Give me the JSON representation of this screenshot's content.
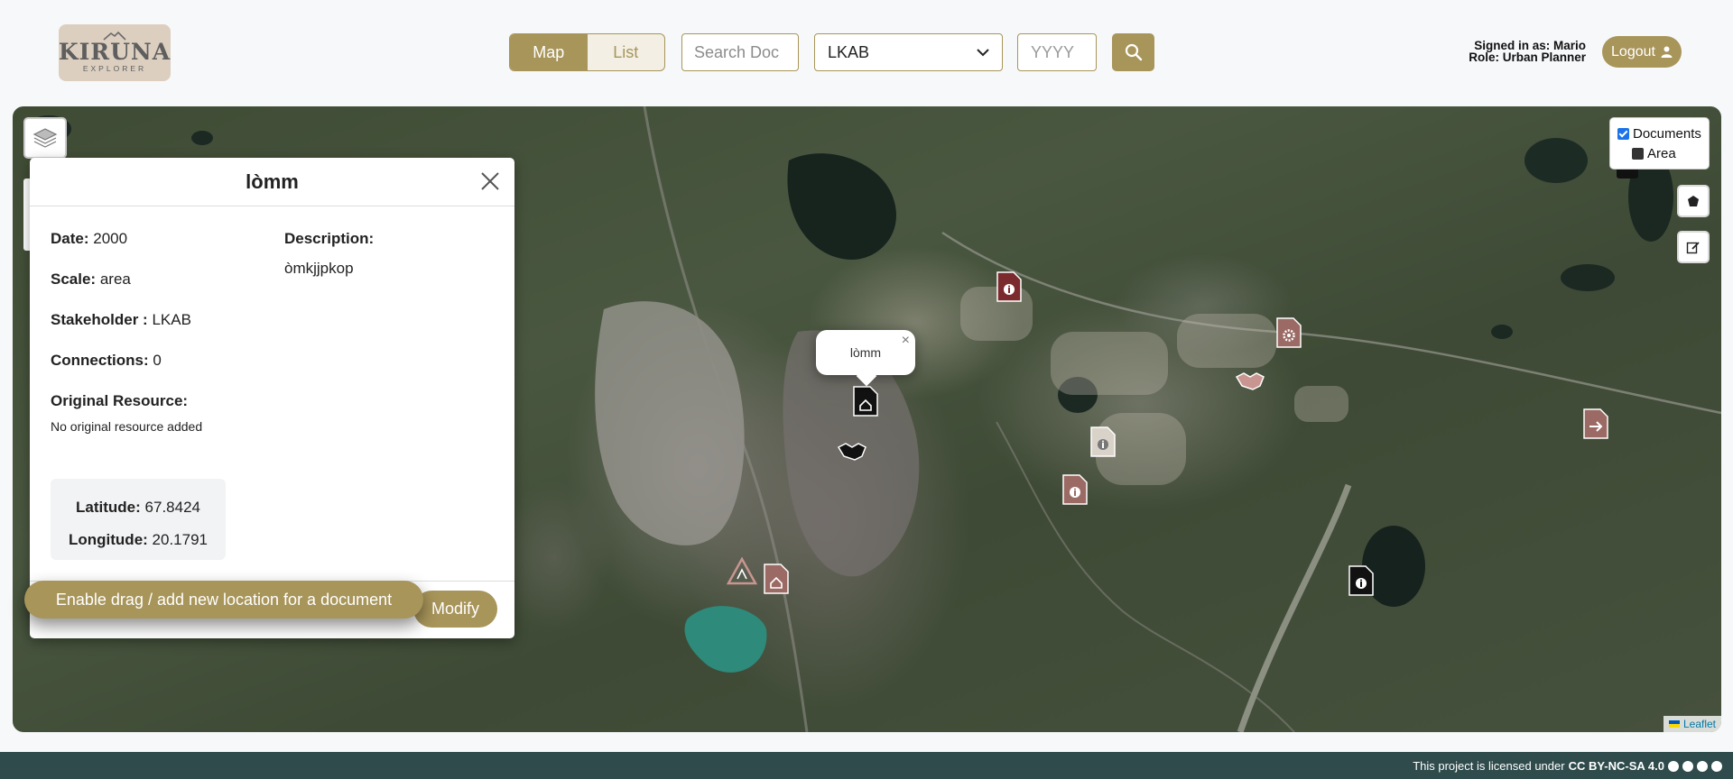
{
  "brand": {
    "logo_main": "KIRUNA",
    "logo_sub": "EXPLORER"
  },
  "view_toggle": {
    "map_label": "Map",
    "list_label": "List",
    "active": "Map"
  },
  "filters": {
    "search_placeholder": "Search Doc",
    "stakeholder_selected": "LKAB",
    "year_placeholder": "YYYY",
    "search_icon": "search-icon"
  },
  "user": {
    "signed_in_label": "Signed in as: Mario",
    "role_label": "Role: Urban Planner",
    "logout_label": "Logout",
    "logout_icon": "user-icon"
  },
  "map_controls": {
    "layers_icon": "layers-icon",
    "legend": [
      {
        "label": "Documents",
        "checked": true
      },
      {
        "label": "Area",
        "checked": false
      }
    ],
    "draw_polygon_icon": "polygon-icon",
    "edit_icon": "edit-icon",
    "attribution": "Leaflet"
  },
  "map_popup": {
    "title": "lòmm"
  },
  "document_panel": {
    "title": "lòmm",
    "date_label": "Date:",
    "date_value": "2000",
    "scale_label": "Scale:",
    "scale_value": "area",
    "stakeholder_label": "Stakeholder :",
    "stakeholder_value": "LKAB",
    "connections_label": "Connections:",
    "connections_value": "0",
    "original_resource_label": "Original Resource:",
    "original_resource_value": "No original resource added",
    "description_label": "Description:",
    "description_value": "òmkjjpkop",
    "latitude_label": "Latitude:",
    "latitude_value": "67.8424",
    "longitude_label": "Longitude:",
    "longitude_value": "20.1791",
    "modify_label": "Modify"
  },
  "enable_drag_label": "Enable drag / add new location for a document",
  "footer": {
    "license_prefix": "This project is licensed under",
    "license_name": "CC BY-NC-SA 4.0"
  },
  "colors": {
    "accent": "#a8955a",
    "footer_bg": "#2f4b4c",
    "marker_dark": "#111111",
    "marker_red": "#7b2a2e",
    "marker_rose": "#9b6a64",
    "marker_light": "#d8d2c8"
  }
}
